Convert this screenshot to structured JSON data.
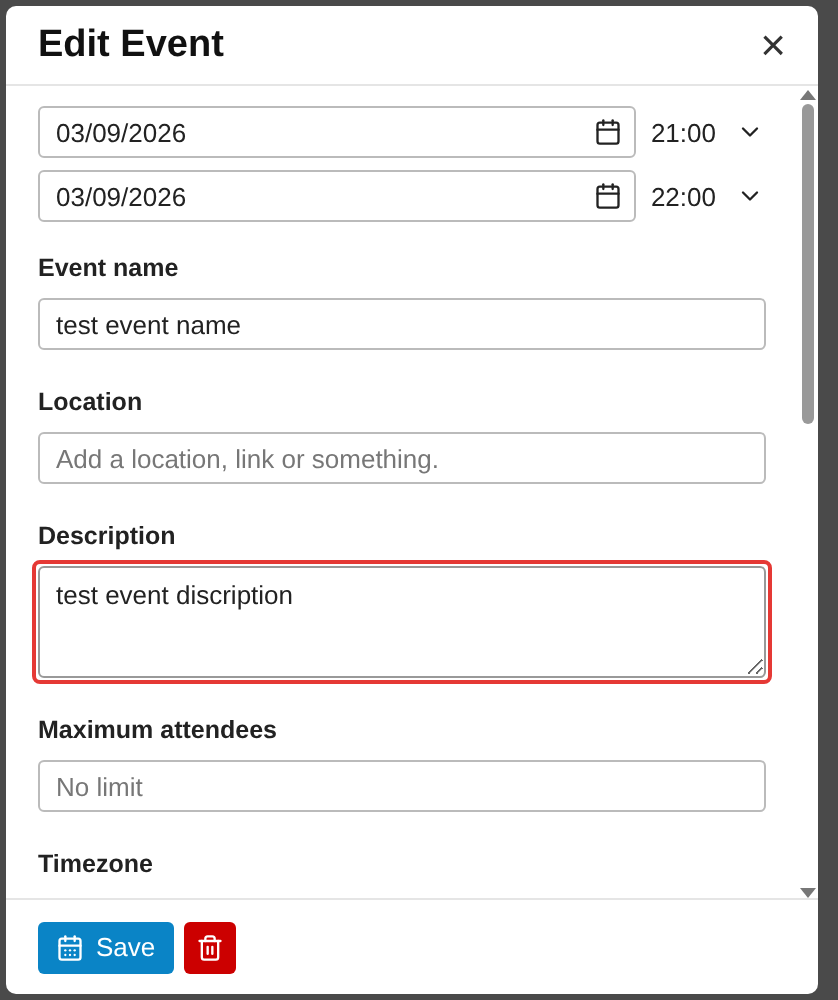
{
  "dialog": {
    "title": "Edit Event",
    "close": "×"
  },
  "schedule": [
    {
      "date": "03/09/2026",
      "time": "21:00"
    },
    {
      "date": "03/09/2026",
      "time": "22:00"
    }
  ],
  "fields": [
    {
      "kind": "input",
      "label": "Event name",
      "value": "test event name",
      "highlighted": false
    },
    {
      "kind": "input",
      "label": "Location",
      "placeholder": "Add a location, link or something.",
      "highlighted": false
    },
    {
      "kind": "textarea",
      "label": "Description",
      "value": "test event discription",
      "highlighted": true
    },
    {
      "kind": "input",
      "label": "Maximum attendees",
      "placeholder": "No limit",
      "highlighted": false
    },
    {
      "kind": "heading",
      "label": "Timezone"
    }
  ],
  "footer": {
    "save": "Save"
  }
}
